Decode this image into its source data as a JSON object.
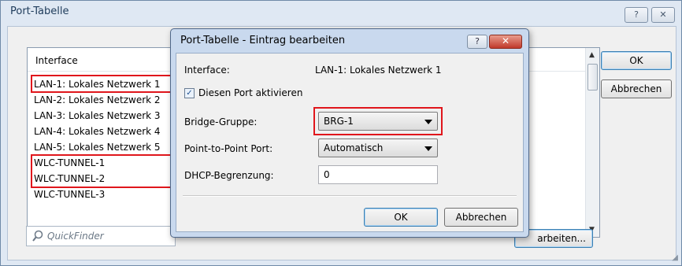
{
  "outer": {
    "title": "Port-Tabelle",
    "help_label": "?",
    "close_label": "✕",
    "list_header": "Interface",
    "rows": [
      "LAN-1: Lokales Netzwerk 1",
      "LAN-2: Lokales Netzwerk 2",
      "LAN-3: Lokales Netzwerk 3",
      "LAN-4: Lokales Netzwerk 4",
      "LAN-5: Lokales Netzwerk 5",
      "WLC-TUNNEL-1",
      "WLC-TUNNEL-2",
      "WLC-TUNNEL-3"
    ],
    "quickfinder_placeholder": "QuickFinder",
    "ok_label": "OK",
    "cancel_label": "Abbrechen",
    "edit_label": "arbeiten..."
  },
  "dialog": {
    "title": "Port-Tabelle - Eintrag bearbeiten",
    "help_label": "?",
    "close_label": "✕",
    "interface_label": "Interface:",
    "interface_value": "LAN-1: Lokales Netzwerk 1",
    "enable_label": "Diesen Port aktivieren",
    "enable_checked": true,
    "bridge_label": "Bridge-Gruppe:",
    "bridge_value": "BRG-1",
    "p2p_label": "Point-to-Point Port:",
    "p2p_value": "Automatisch",
    "dhcp_label": "DHCP-Begrenzung:",
    "dhcp_value": "0",
    "ok_label": "OK",
    "cancel_label": "Abbrechen"
  },
  "colors": {
    "highlight_red": "#e0161c",
    "title_bar_blue": "#c9d9ee",
    "close_red": "#c0392b"
  }
}
